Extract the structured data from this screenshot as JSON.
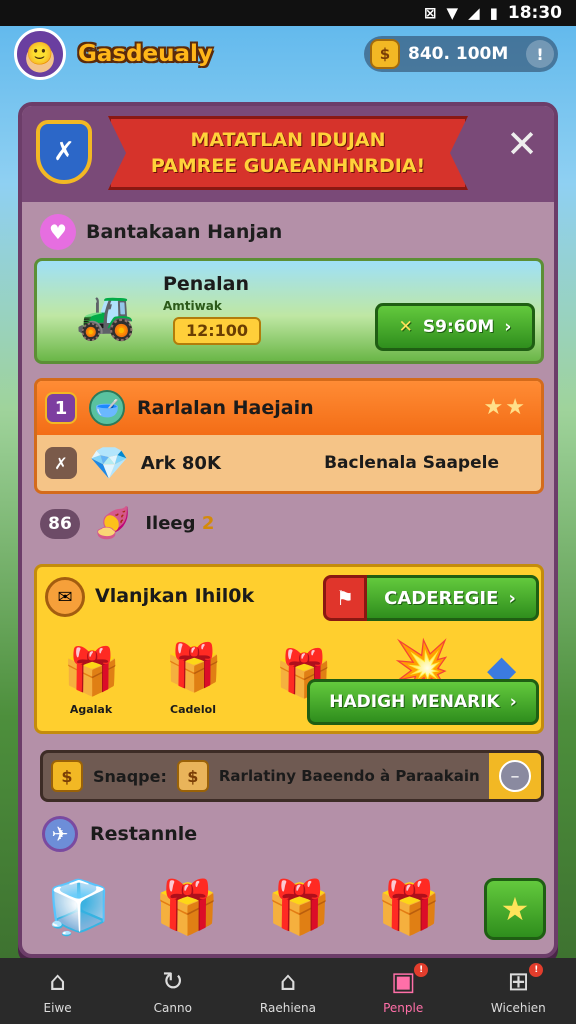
{
  "status_bar": {
    "time": "18:30"
  },
  "top_bar": {
    "title": "Gasdeualy",
    "coins": "840. 100M"
  },
  "panel": {
    "banner_line1": "MATATLAN IDUJAN",
    "banner_line2": "PAMREE GUAEANHNRDIA!",
    "section1_title": "Bantakaan Hanjan",
    "mission": {
      "title": "Penalan",
      "subtitle": "Amtiwak",
      "timer": "12:100",
      "button_label": "S9:60M"
    },
    "orange_card": {
      "number": "1",
      "title": "Rarlalan Haejain",
      "stars": "★★",
      "row2_value": "Ark 80K",
      "row2_desc": "Baclenala Saapele"
    },
    "level": {
      "number": "86",
      "label": "Ileeg",
      "value": "2"
    },
    "reward": {
      "title": "Vlanjkan Ihil0k",
      "button_label": "CADEREGIE",
      "gift1_label": "Agalak",
      "gift2_label": "Cadelol",
      "claim_label": "HADIGH MENARIK"
    },
    "info_bar": {
      "label": "Snaqpe:",
      "desc": "Rarlatiny Baeendo à Paraakain"
    },
    "collect": {
      "title": "Restannle"
    }
  },
  "bottom_nav": [
    {
      "label": "Eiwe",
      "icon": "home-icon",
      "badge": ""
    },
    {
      "label": "Canno",
      "icon": "refresh-icon",
      "badge": ""
    },
    {
      "label": "Raehiena",
      "icon": "house-icon",
      "badge": ""
    },
    {
      "label": "Penple",
      "icon": "package-icon",
      "badge": "!"
    },
    {
      "label": "Wicehien",
      "icon": "grid-icon",
      "badge": "!"
    }
  ]
}
